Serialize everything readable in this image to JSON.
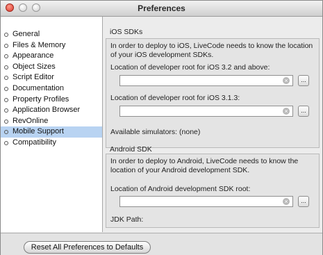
{
  "window": {
    "title": "Preferences"
  },
  "sidebar": {
    "items": [
      {
        "label": "General"
      },
      {
        "label": "Files & Memory"
      },
      {
        "label": "Appearance"
      },
      {
        "label": "Object Sizes"
      },
      {
        "label": "Script Editor"
      },
      {
        "label": "Documentation"
      },
      {
        "label": "Property Profiles"
      },
      {
        "label": "Application Browser"
      },
      {
        "label": "RevOnline"
      },
      {
        "label": "Mobile Support"
      },
      {
        "label": "Compatibility"
      }
    ],
    "selected": "Mobile Support"
  },
  "ios": {
    "heading": "iOS SDKs",
    "description": "In order to deploy to iOS, LiveCode needs to know the location of your iOS development SDKs.",
    "root32_label": "Location of developer root for iOS 3.2 and above:",
    "root32_value": "",
    "root313_label": "Location of developer root for iOS 3.1.3:",
    "root313_value": "",
    "simulators": "Available simulators: (none)",
    "browse_label": "..."
  },
  "android": {
    "heading": "Android SDK",
    "description": "In order to deploy to Android, LiveCode needs to know the location of your Android development SDK.",
    "sdk_label": "Location of Android development SDK root:",
    "sdk_value": "",
    "jdk_label": "JDK Path:",
    "browse_label": "..."
  },
  "footer": {
    "reset_label": "Reset All Preferences to Defaults"
  },
  "icons": {
    "close": "close-icon",
    "clear": "clear-field-icon"
  }
}
